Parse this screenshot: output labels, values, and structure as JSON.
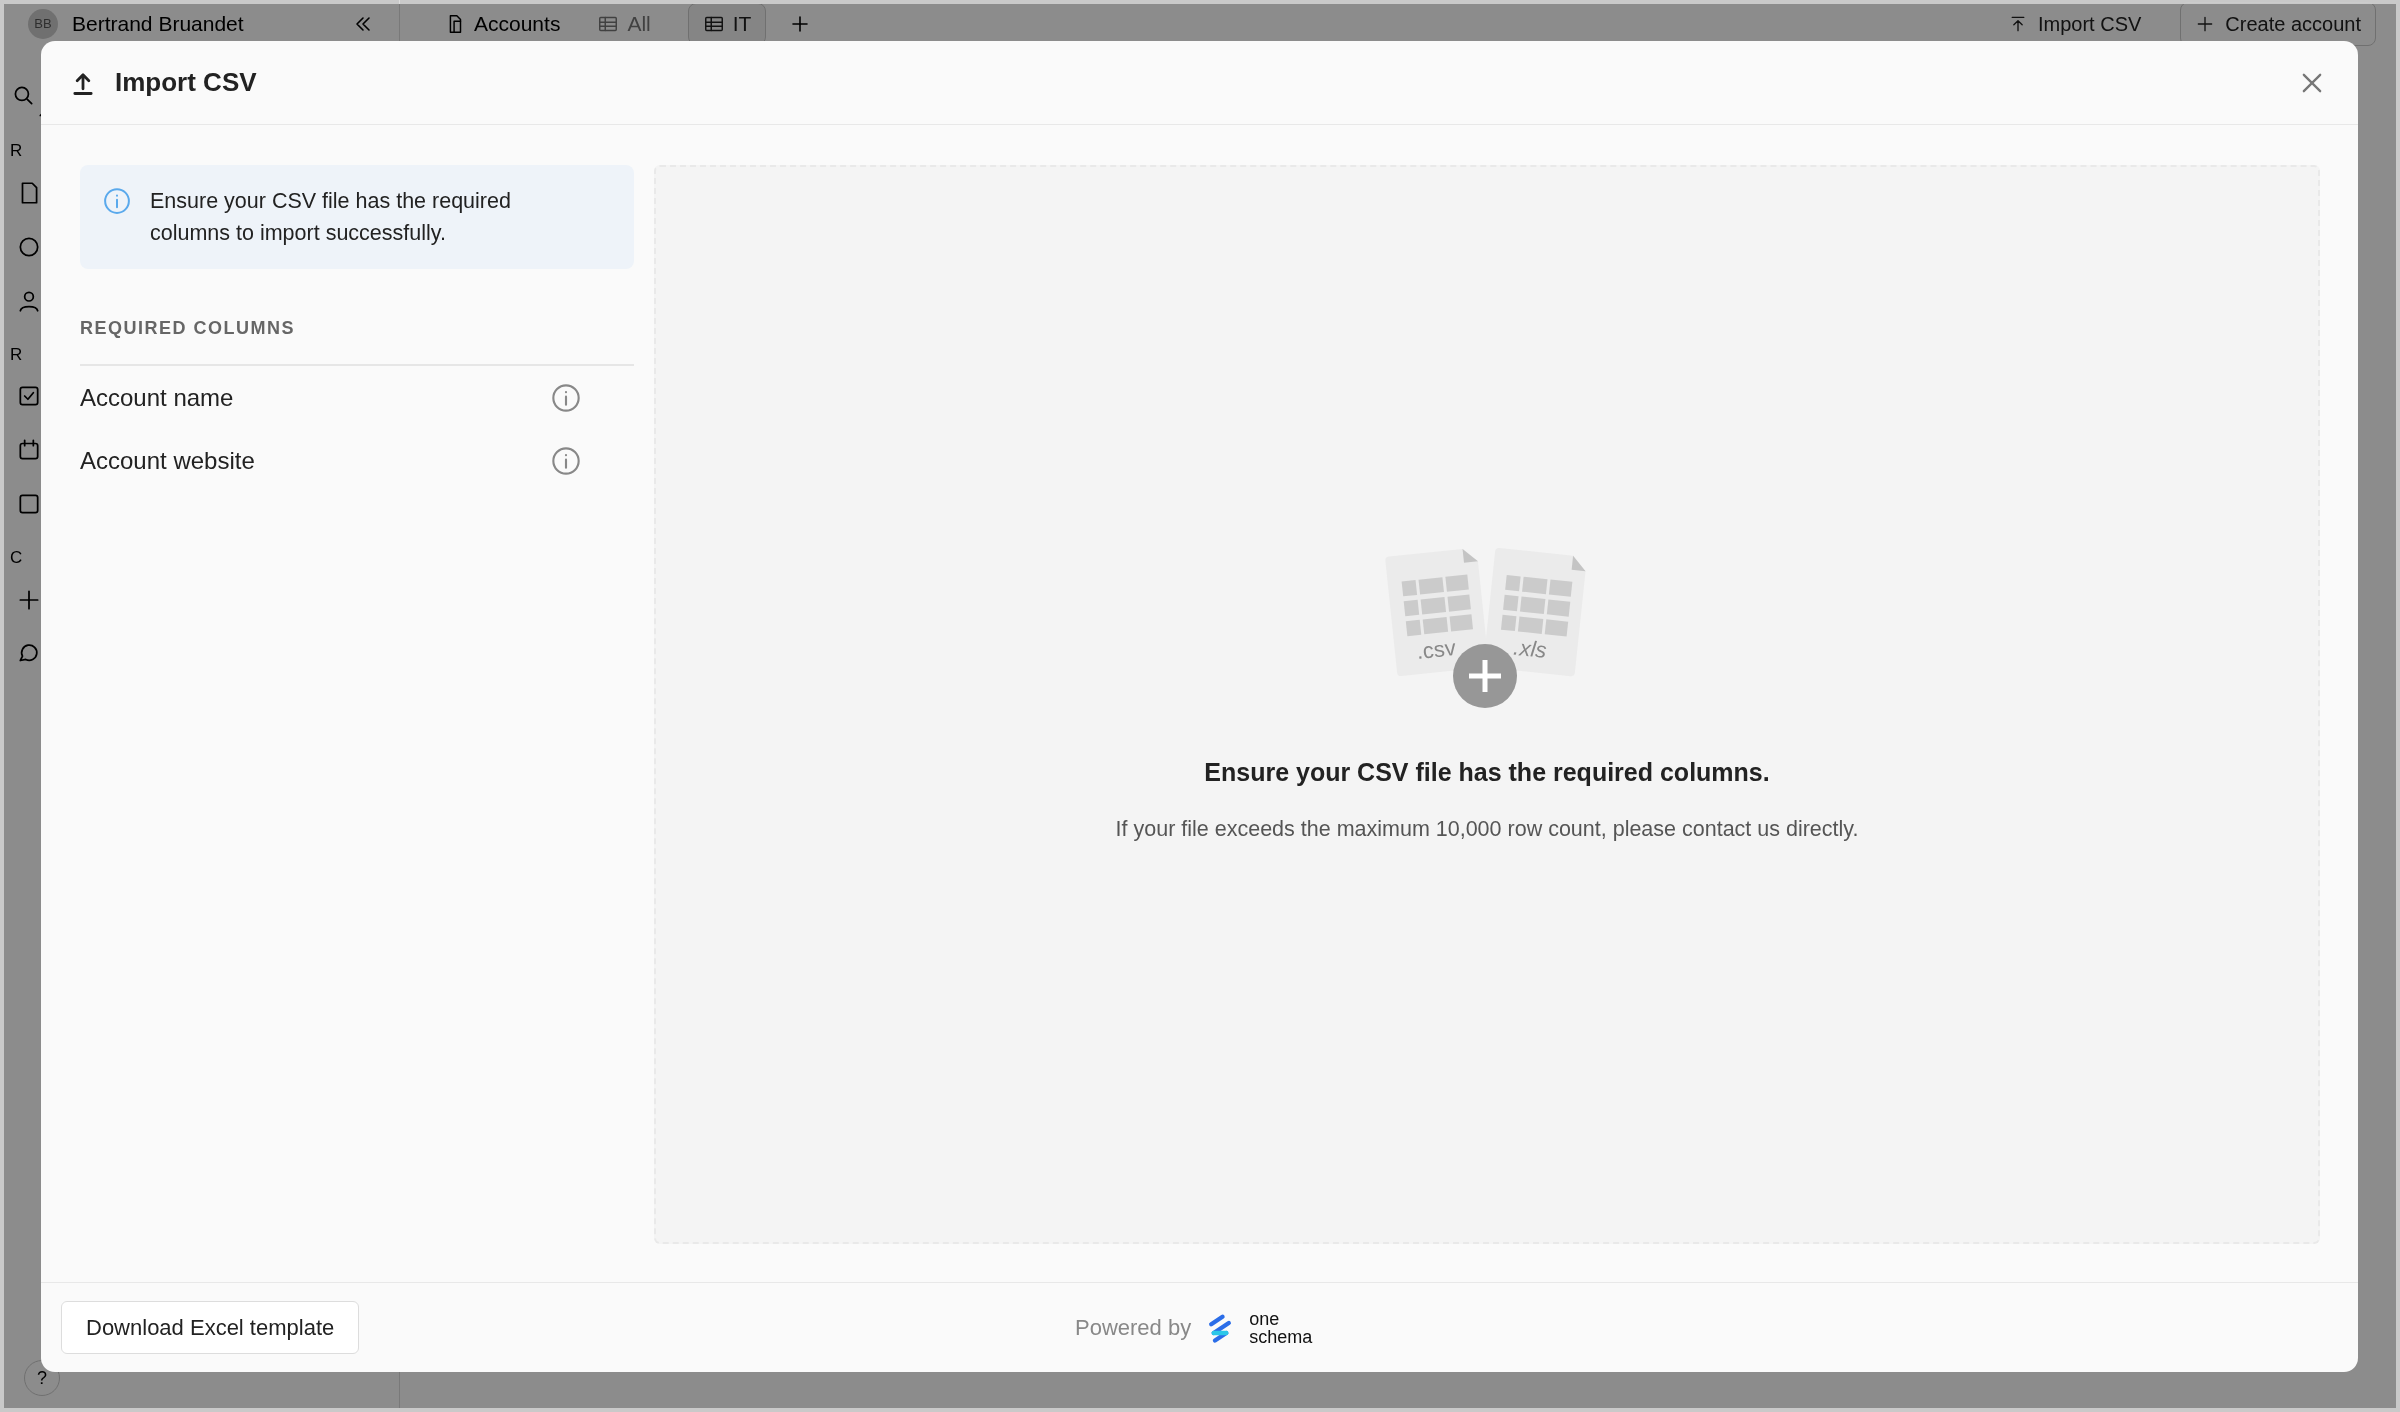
{
  "background_app": {
    "user": {
      "initials": "BB",
      "name": "Bertrand Bruandet"
    },
    "breadcrumb": "Accounts",
    "views": [
      {
        "label": "All",
        "selected": false
      },
      {
        "label": "IT",
        "selected": true
      }
    ],
    "actions": [
      {
        "label": "Import CSV",
        "kind": "link"
      },
      {
        "label": "Create account",
        "kind": "button"
      }
    ],
    "sidebar_section_labels": [
      "R",
      "R",
      "C"
    ],
    "help": "?"
  },
  "modal": {
    "title": "Import CSV",
    "info": "Ensure your CSV file has the required columns to import successfully.",
    "required_columns_heading": "REQUIRED COLUMNS",
    "required_columns": [
      "Account name",
      "Account website"
    ],
    "dropzone": {
      "file_labels": [
        ".csv",
        ".xls"
      ],
      "heading": "Ensure your CSV file has the required columns.",
      "note": "If your file exceeds the maximum 10,000 row count, please contact us directly."
    },
    "footer": {
      "button": "Download Excel template",
      "powered_by": "Powered by",
      "brand": [
        "one",
        "schema"
      ]
    }
  }
}
